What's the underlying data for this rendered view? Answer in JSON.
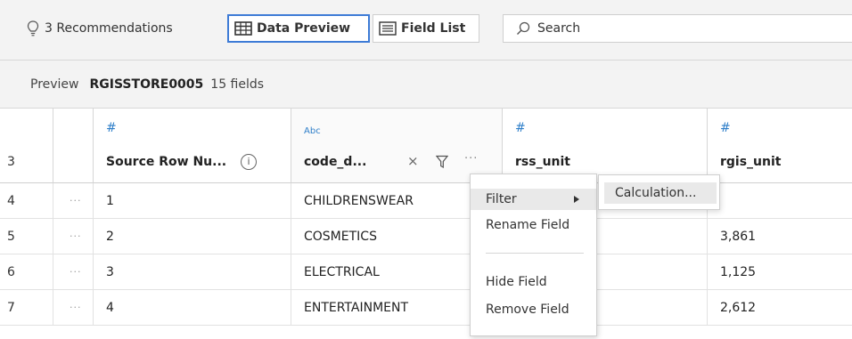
{
  "toolbar": {
    "recommendations_label": "3 Recommendations",
    "data_preview_label": "Data Preview",
    "field_list_label": "Field List",
    "search_placeholder": "Search"
  },
  "subheader": {
    "preview_label": "Preview",
    "table_name": "RGISSTORE0005",
    "field_count": "15 fields"
  },
  "columns": {
    "row_header": "3",
    "source_row": {
      "type": "#",
      "name": "Source Row Nu...",
      "info": "i"
    },
    "code_d": {
      "type": "Abc",
      "name": "code_d...",
      "clear": "×",
      "more": "···"
    },
    "rss_unit": {
      "type": "#",
      "name": "rss_unit"
    },
    "rgis_unit": {
      "type": "#",
      "name": "rgis_unit"
    }
  },
  "rows": [
    {
      "rn": "4",
      "dots": "···",
      "source": "1",
      "code": "CHILDRENSWEAR",
      "rss": "",
      "rgis": ""
    },
    {
      "rn": "5",
      "dots": "···",
      "source": "2",
      "code": "COSMETICS",
      "rss": "",
      "rgis": "3,861"
    },
    {
      "rn": "6",
      "dots": "···",
      "source": "3",
      "code": "ELECTRICAL",
      "rss": "",
      "rgis": "1,125"
    },
    {
      "rn": "7",
      "dots": "···",
      "source": "4",
      "code": "ENTERTAINMENT",
      "rss": "",
      "rgis": "2,612"
    }
  ],
  "context_menu": {
    "items": [
      {
        "label": "Filter"
      },
      {
        "label": "Rename Field"
      },
      {
        "label": "Hide Field"
      },
      {
        "label": "Remove Field"
      }
    ],
    "submenu": {
      "label": "Calculation..."
    }
  },
  "colors": {
    "accent": "#3d7bd6",
    "type_icon": "#2f7fc9"
  }
}
